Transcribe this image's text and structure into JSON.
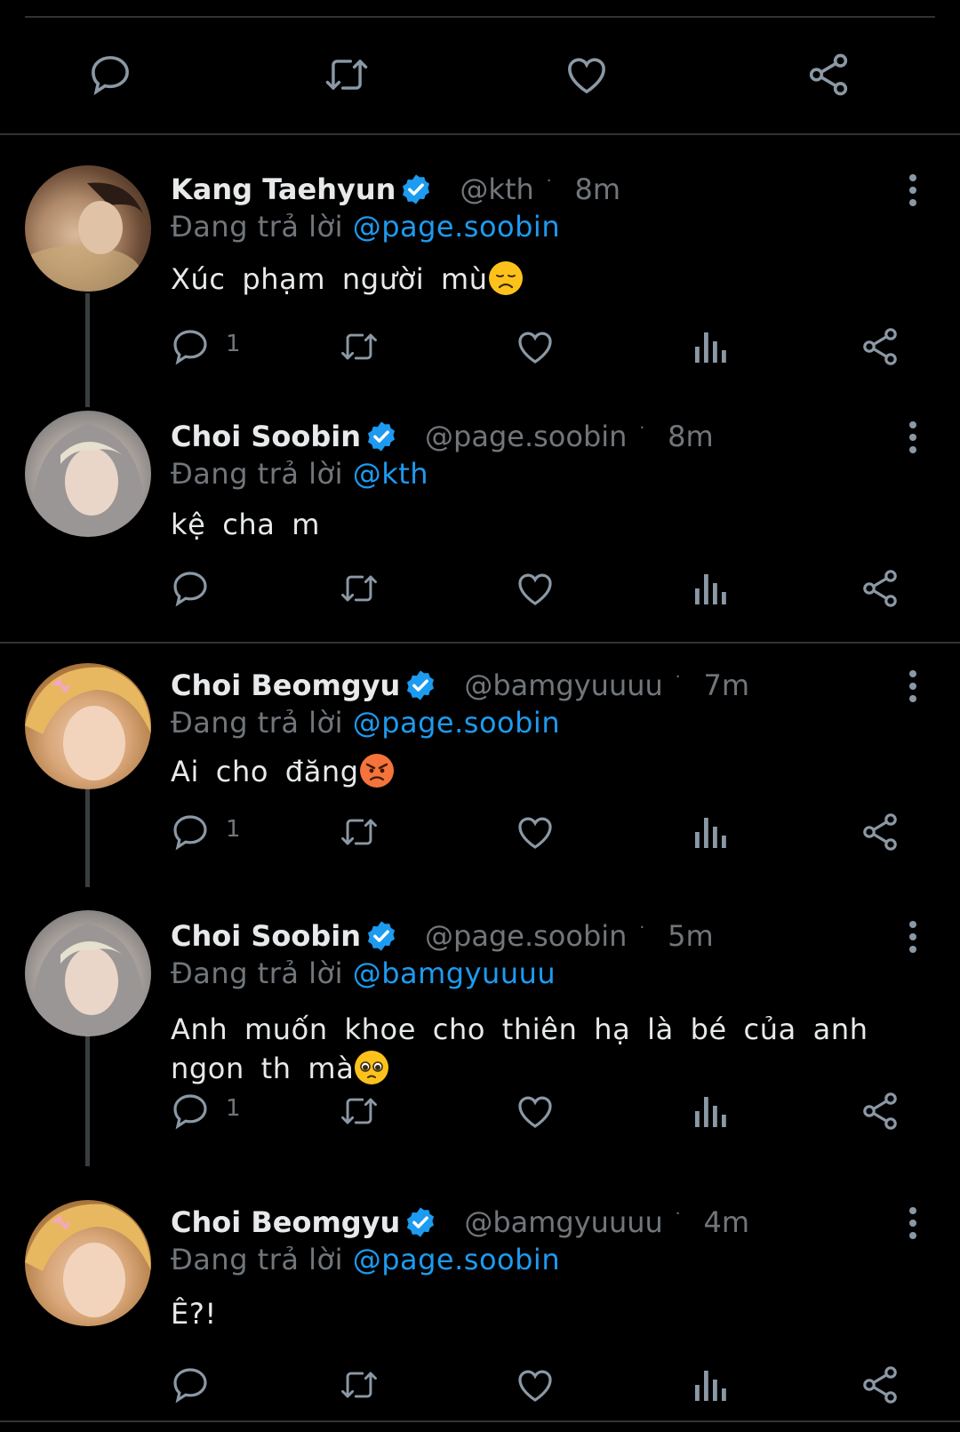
{
  "top_actions": {
    "icons": [
      "reply-icon",
      "retweet-icon",
      "like-icon",
      "share-icon"
    ]
  },
  "colors": {
    "background": "#000000",
    "text": "#e7e9ea",
    "muted": "#71767b",
    "accent": "#1d9bf0",
    "divider": "#2f3336"
  },
  "tweets": [
    {
      "name": "Kang Taehyun",
      "handle": "@kth",
      "dot": "·",
      "time": "8m",
      "reply_prefix": "Đang trả lời ",
      "reply_to": "@page.soobin",
      "text": "Xúc phạm người mù",
      "emoji": "disappointed-face-emoji",
      "reply_count": "1"
    },
    {
      "name": "Choi Soobin",
      "handle": "@page.soobin",
      "dot": "·",
      "time": "8m",
      "reply_prefix": "Đang trả lời ",
      "reply_to": "@kth",
      "text": "kệ cha m",
      "reply_count": ""
    },
    {
      "name": "Choi Beomgyu",
      "handle": "@bamgyuuuu",
      "dot": "·",
      "time": "7m",
      "reply_prefix": "Đang trả lời ",
      "reply_to": "@page.soobin",
      "text": "Ai cho đăng",
      "emoji": "angry-face-emoji",
      "reply_count": "1"
    },
    {
      "name": "Choi Soobin",
      "handle": "@page.soobin",
      "dot": "·",
      "time": "5m",
      "reply_prefix": "Đang trả lời ",
      "reply_to": "@bamgyuuuu",
      "text": "Anh muốn khoe cho thiên hạ là bé của anh ngon th mà",
      "emoji": "pleading-face-emoji",
      "reply_count": "1"
    },
    {
      "name": "Choi Beomgyu",
      "handle": "@bamgyuuuu",
      "dot": "·",
      "time": "4m",
      "reply_prefix": "Đang trả lời ",
      "reply_to": "@page.soobin",
      "text": "Ê?!",
      "reply_count": ""
    }
  ]
}
